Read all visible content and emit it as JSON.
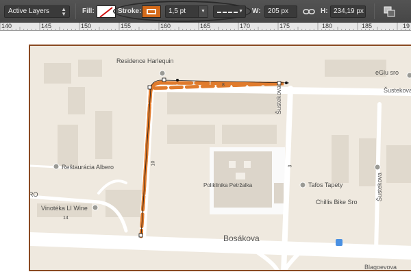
{
  "options_bar": {
    "layer_filter": "Active Layers",
    "fill_label": "Fill:",
    "stroke_label": "Stroke:",
    "stroke_width": "1,5 pt",
    "width_label": "W:",
    "width_value": "205 px",
    "height_label": "H:",
    "height_value": "234,19 px",
    "stroke_color": "#d36a1a"
  },
  "ruler": {
    "labels": [
      "140",
      "145",
      "150",
      "155",
      "160",
      "165",
      "170",
      "175",
      "180",
      "185",
      "19"
    ]
  },
  "map": {
    "places": {
      "residence": "Residence Harlequin",
      "eglu": "eGlu sro",
      "albero": "Reštaurácia Albero",
      "poliklinika": "Poliklinika Petržalka",
      "tafos": "Tafos Tapety",
      "chillis": "Chillis Bike Sro",
      "vinoteka": "Vinotéka LI Wine",
      "sro": "RO"
    },
    "streets": {
      "bosakova": "Bosákova",
      "sustekova_v": "Šustekova",
      "sustekova_h": "Šustekova",
      "blagoevova": "Blagoevova"
    },
    "numbers": {
      "n8": "8",
      "n10": "10",
      "n3": "3",
      "n14": "14"
    },
    "path_color": "#e07b2c"
  }
}
